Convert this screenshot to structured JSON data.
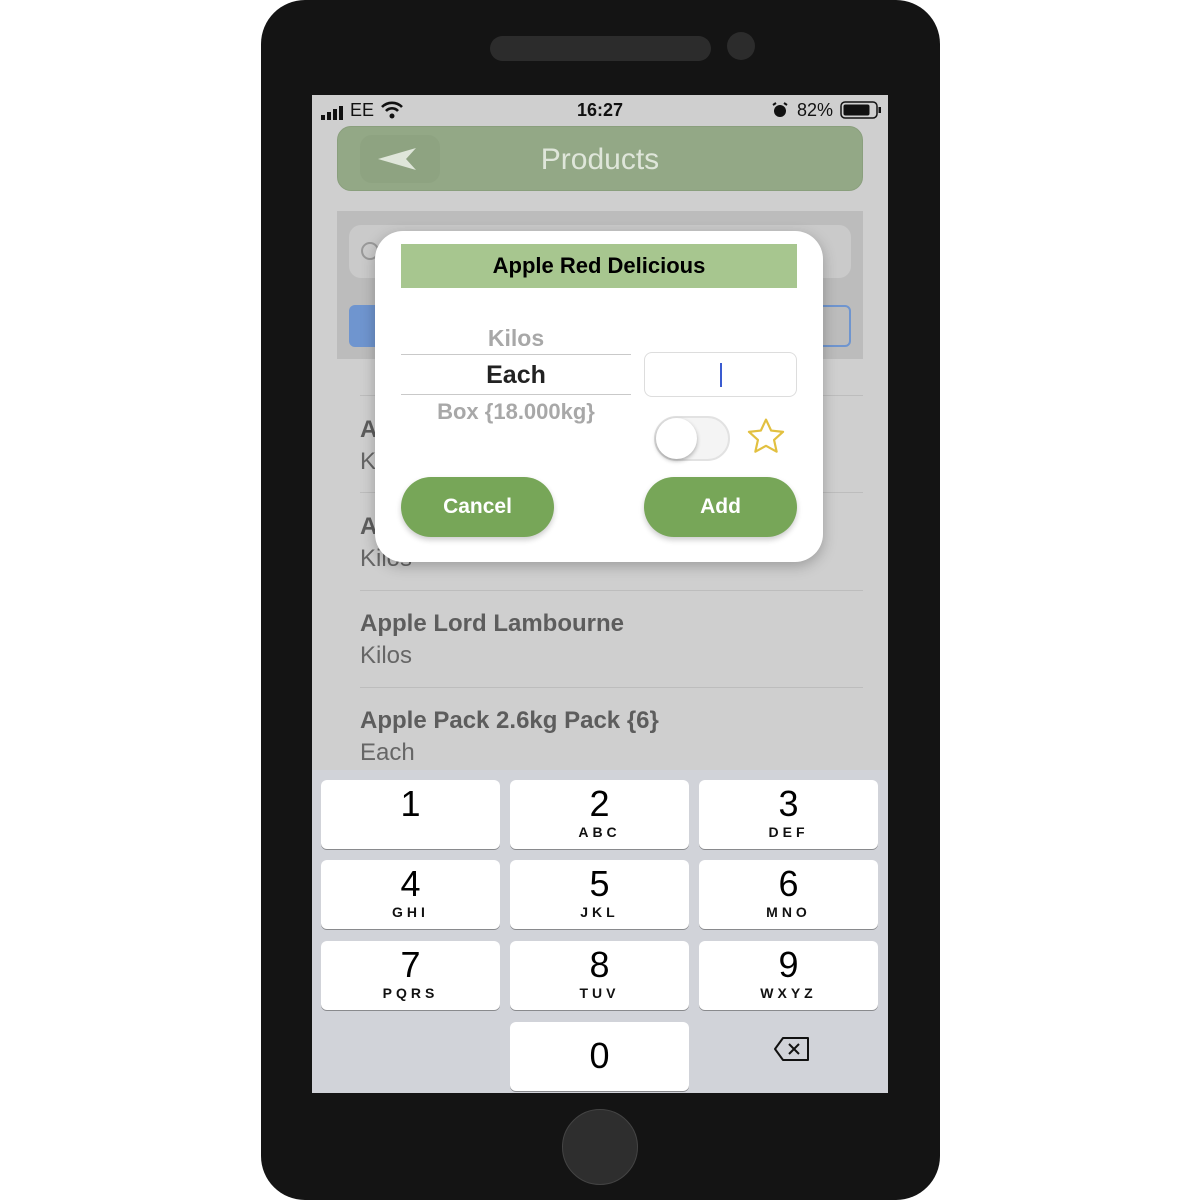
{
  "status_bar": {
    "carrier": "EE",
    "time": "16:27",
    "battery": "82%",
    "battery_level": 0.82
  },
  "header": {
    "title": "Products",
    "back_icon": "chevron-left-icon"
  },
  "list": [
    {
      "title": "A",
      "subtitle": "K"
    },
    {
      "title": "A",
      "subtitle": "Kilos"
    },
    {
      "title": "Apple Lord Lambourne",
      "subtitle": "Kilos"
    },
    {
      "title": "Apple Pack 2.6kg Pack {6}",
      "subtitle": "Each"
    }
  ],
  "modal": {
    "title": "Apple Red Delicious",
    "units": [
      "Kilos",
      "Each",
      "Box {18.000kg}"
    ],
    "selected_unit": "Each",
    "quantity": "",
    "toggle_on": false,
    "favorite": false,
    "cancel_label": "Cancel",
    "add_label": "Add",
    "accent": "#77a658",
    "star_color": "#e2c040"
  },
  "keypad": [
    {
      "num": "1",
      "letters": ""
    },
    {
      "num": "2",
      "letters": "ABC"
    },
    {
      "num": "3",
      "letters": "DEF"
    },
    {
      "num": "4",
      "letters": "GHI"
    },
    {
      "num": "5",
      "letters": "JKL"
    },
    {
      "num": "6",
      "letters": "MNO"
    },
    {
      "num": "7",
      "letters": "PQRS"
    },
    {
      "num": "8",
      "letters": "TUV"
    },
    {
      "num": "9",
      "letters": "WXYZ"
    },
    {
      "num": "0",
      "letters": ""
    }
  ]
}
